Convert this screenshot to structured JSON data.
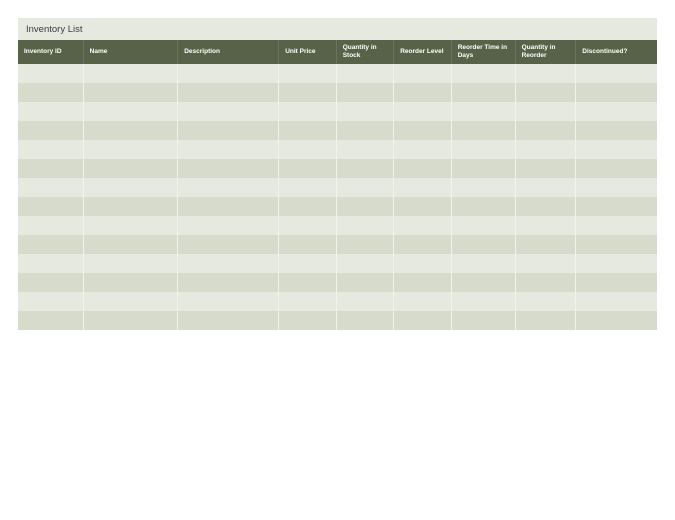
{
  "title": "Inventory List",
  "columns": [
    "Inventory ID",
    "Name",
    "Description",
    "Unit Price",
    "Quantity in Stock",
    "Reorder Level",
    "Reorder Time in Days",
    "Quantity in Reorder",
    "Discontinued?"
  ],
  "rows": [
    [
      "",
      "",
      "",
      "",
      "",
      "",
      "",
      "",
      ""
    ],
    [
      "",
      "",
      "",
      "",
      "",
      "",
      "",
      "",
      ""
    ],
    [
      "",
      "",
      "",
      "",
      "",
      "",
      "",
      "",
      ""
    ],
    [
      "",
      "",
      "",
      "",
      "",
      "",
      "",
      "",
      ""
    ],
    [
      "",
      "",
      "",
      "",
      "",
      "",
      "",
      "",
      ""
    ],
    [
      "",
      "",
      "",
      "",
      "",
      "",
      "",
      "",
      ""
    ],
    [
      "",
      "",
      "",
      "",
      "",
      "",
      "",
      "",
      ""
    ],
    [
      "",
      "",
      "",
      "",
      "",
      "",
      "",
      "",
      ""
    ],
    [
      "",
      "",
      "",
      "",
      "",
      "",
      "",
      "",
      ""
    ],
    [
      "",
      "",
      "",
      "",
      "",
      "",
      "",
      "",
      ""
    ],
    [
      "",
      "",
      "",
      "",
      "",
      "",
      "",
      "",
      ""
    ],
    [
      "",
      "",
      "",
      "",
      "",
      "",
      "",
      "",
      ""
    ],
    [
      "",
      "",
      "",
      "",
      "",
      "",
      "",
      "",
      ""
    ],
    [
      "",
      "",
      "",
      "",
      "",
      "",
      "",
      "",
      ""
    ]
  ],
  "chart_data": {
    "type": "table",
    "title": "Inventory List",
    "columns": [
      "Inventory ID",
      "Name",
      "Description",
      "Unit Price",
      "Quantity in Stock",
      "Reorder Level",
      "Reorder Time in Days",
      "Quantity in Reorder",
      "Discontinued?"
    ],
    "rows": []
  }
}
